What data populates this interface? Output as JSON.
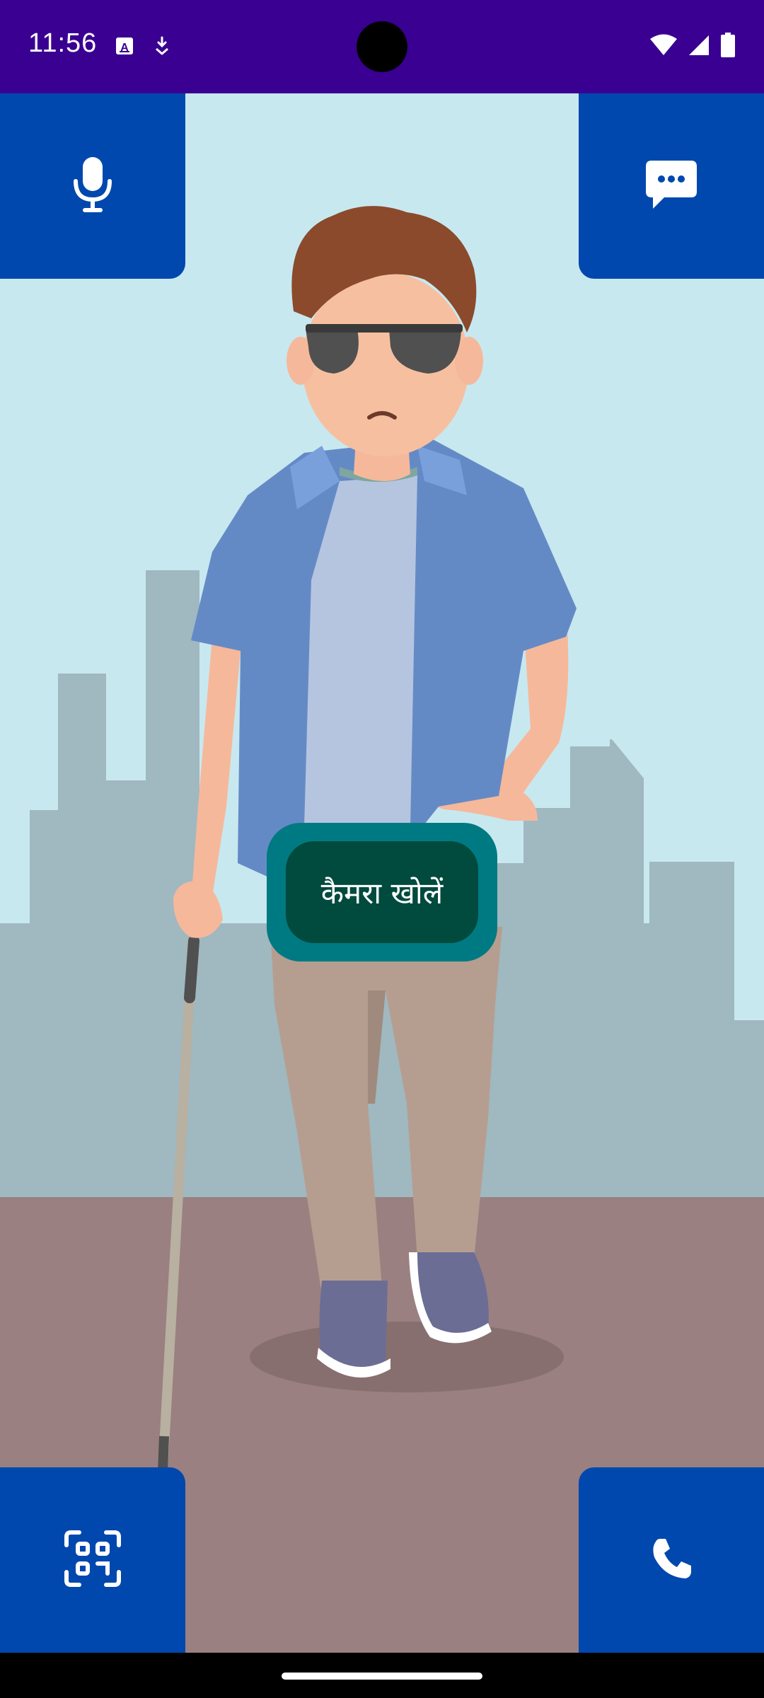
{
  "status_bar": {
    "time": "11:56",
    "left_icons": [
      "text-notification-icon",
      "download-notification-icon"
    ],
    "right_icons": [
      "wifi-icon",
      "cellular-signal-icon",
      "battery-icon"
    ]
  },
  "tiles": {
    "mic": {
      "icon": "microphone-icon"
    },
    "chat": {
      "icon": "chat-bubble-icon"
    },
    "scan": {
      "icon": "qr-scan-icon"
    },
    "call": {
      "icon": "phone-icon"
    }
  },
  "camera_button": {
    "label": "कैमरा खोलें"
  },
  "colors": {
    "status_bar": "#3a0091",
    "tile": "#0048ae",
    "camera_outer": "#007a82",
    "camera_inner": "#004a3e",
    "sky": "#c8e8f0",
    "ground": "#9a8080"
  }
}
